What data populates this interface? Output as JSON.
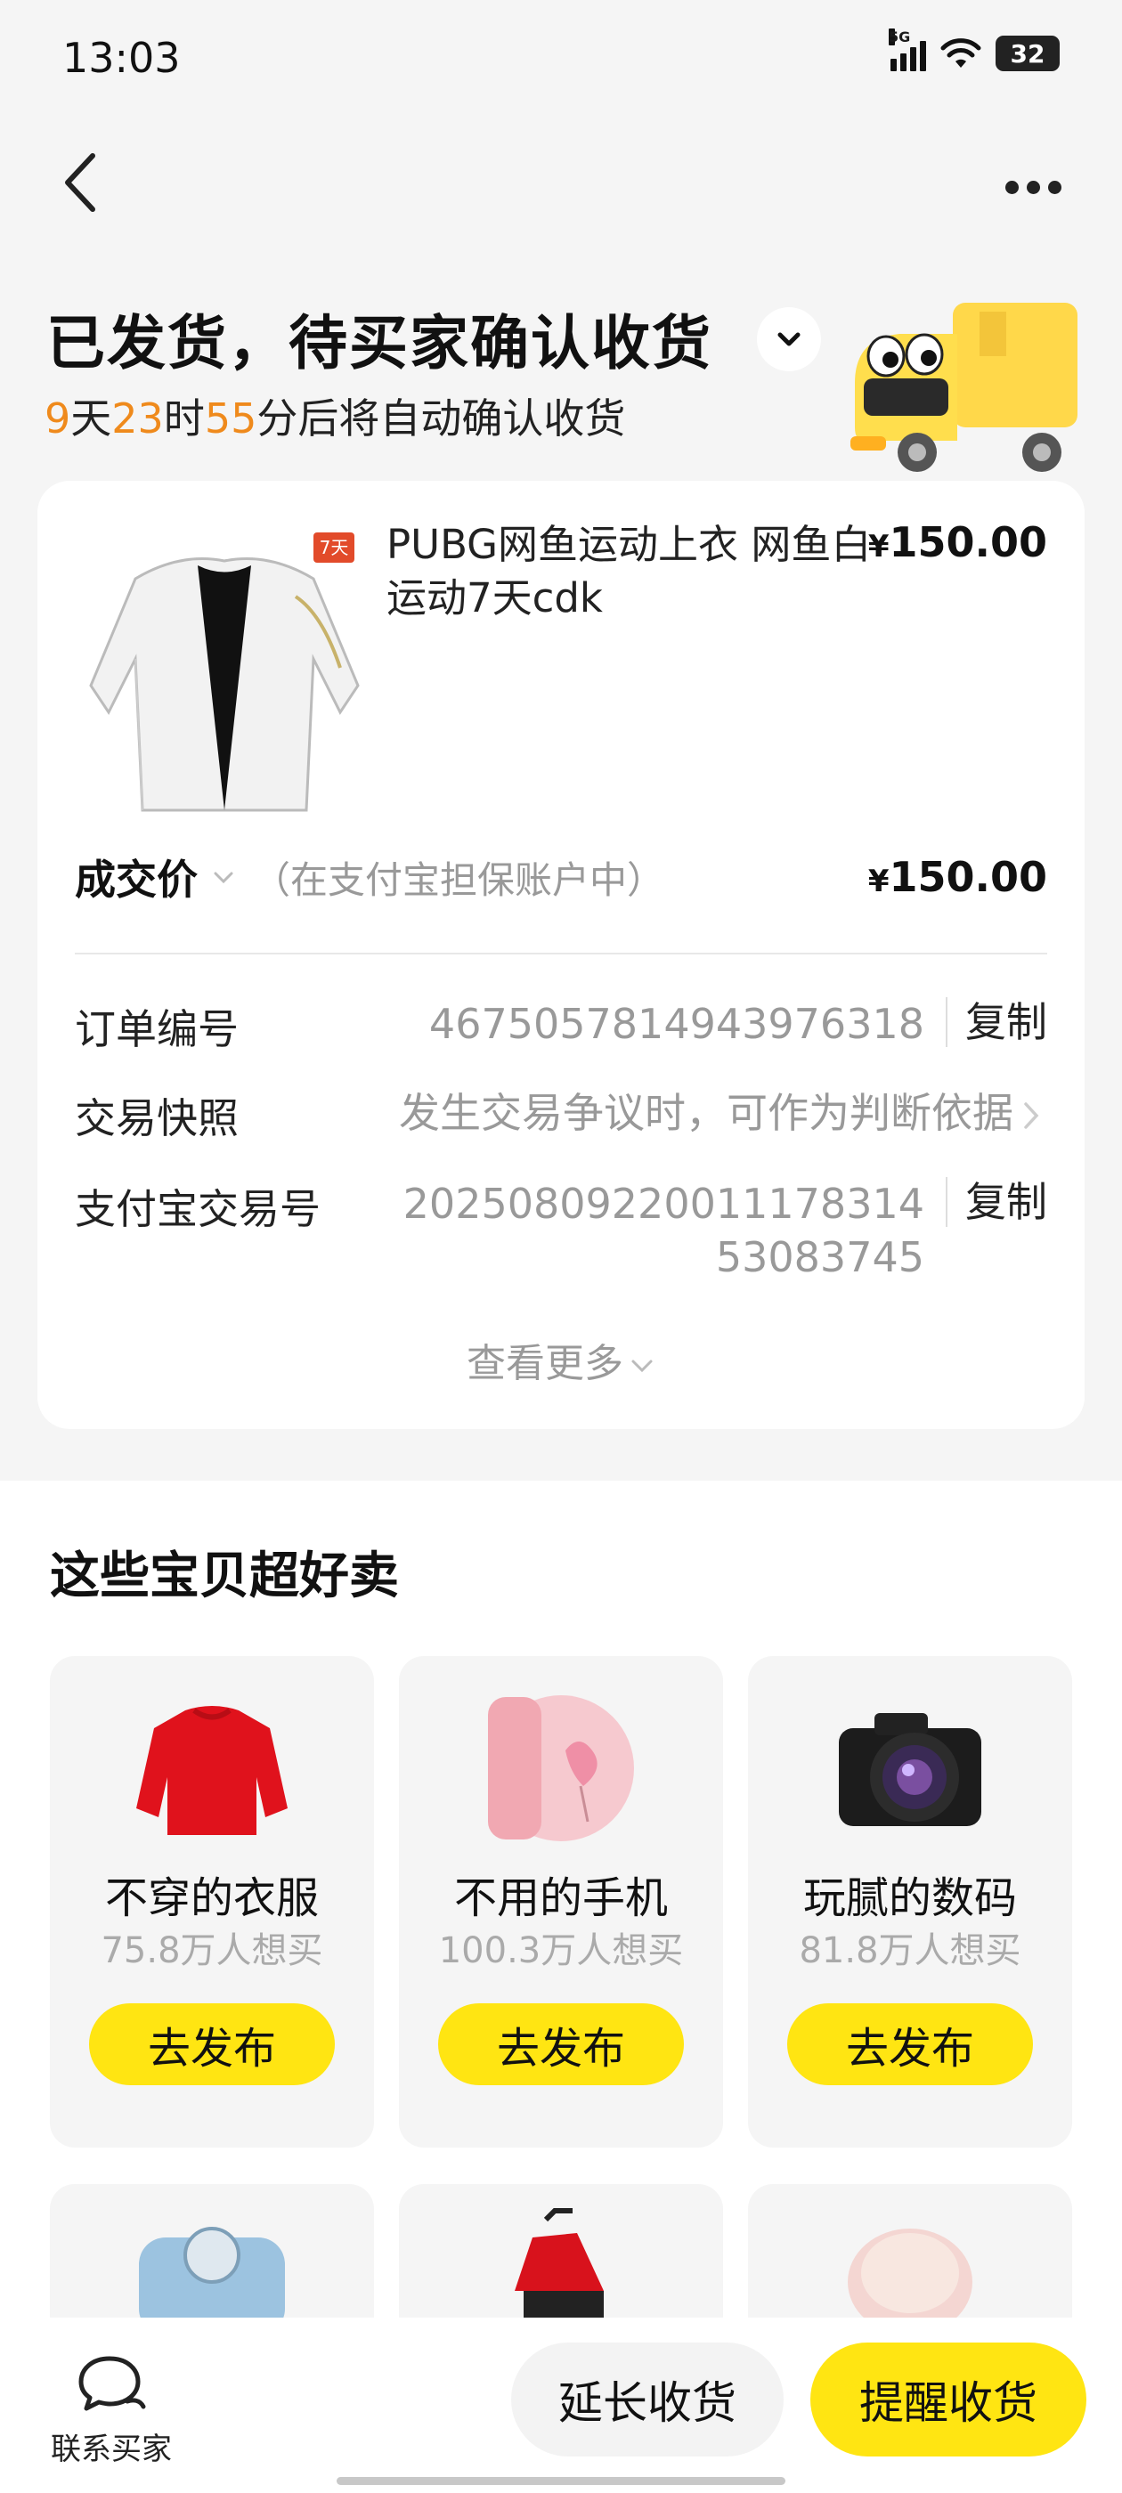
{
  "status_bar": {
    "time": "13:03",
    "network": "5G",
    "battery": "32"
  },
  "header": {
    "title": "已发货，待买家确认收货",
    "countdown": {
      "days": "9",
      "days_unit": "天",
      "hours": "23",
      "hours_unit": "时",
      "minutes": "55",
      "minutes_unit": "分后将自动确认收货"
    }
  },
  "order": {
    "product_title": "PUBG网鱼运动上衣 网鱼白运动7天cdk",
    "product_badge": "7天",
    "price_symbol": "¥",
    "price": "150.00",
    "deal_label": "成交价",
    "deal_note": "（在支付宝担保账户中）",
    "deal_price": "150.00",
    "rows": {
      "order_no_label": "订单编号",
      "order_no_value": "4675057814943976318",
      "snapshot_label": "交易快照",
      "snapshot_value": "发生交易争议时，可作为判断依据",
      "alipay_label": "支付宝交易号",
      "alipay_value_1": "2025080922001117831​4",
      "alipay_value_2": "53083745",
      "copy": "复制"
    },
    "see_more": "查看更多"
  },
  "recommend": {
    "title": "这些宝贝超好卖",
    "tiles": [
      {
        "name": "不穿的衣服",
        "count": "75.8万人想买",
        "button": "去发布"
      },
      {
        "name": "不用的手机",
        "count": "100.3万人想买",
        "button": "去发布"
      },
      {
        "name": "玩腻的数码",
        "count": "81.8万人想买",
        "button": "去发布"
      }
    ]
  },
  "bottom_bar": {
    "contact": "联系买家",
    "extend": "延长收货",
    "remind": "提醒收货"
  },
  "colors": {
    "accent_yellow": "#ffe512",
    "countdown_orange": "#ef8a1c"
  }
}
